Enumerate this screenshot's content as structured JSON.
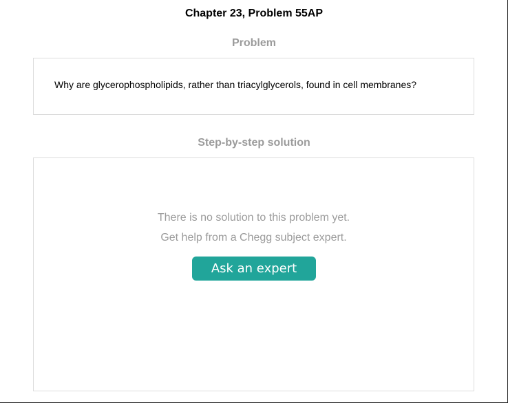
{
  "header": {
    "chapter_title": "Chapter 23, Problem 55AP"
  },
  "problem": {
    "heading": "Problem",
    "text": "Why are glycerophospholipids, rather than triacylglycerols, found in cell membranes?"
  },
  "solution": {
    "heading": "Step-by-step solution",
    "no_solution_text": "There is no solution to this problem yet.",
    "get_help_text": "Get help from a Chegg subject expert.",
    "ask_button_label": "Ask an expert",
    "accent_color": "#21a59a"
  }
}
